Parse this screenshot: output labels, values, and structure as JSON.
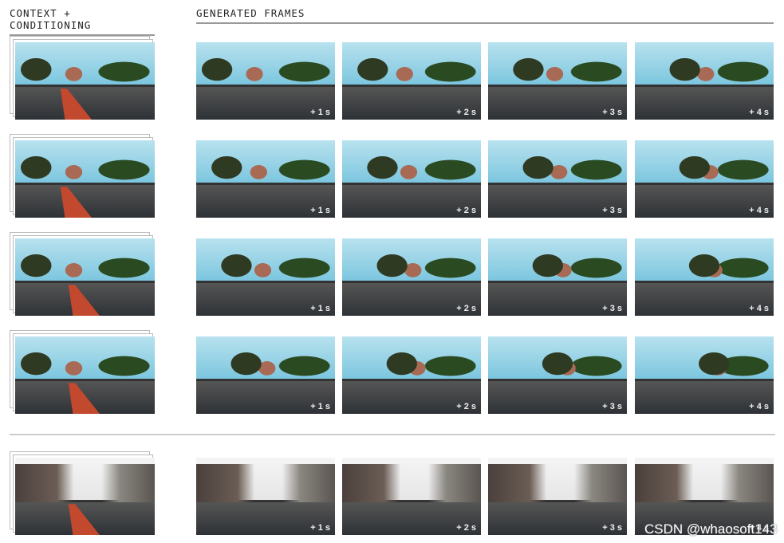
{
  "headers": {
    "context": "CONTEXT + CONDITIONING",
    "generated": "GENERATED FRAMES"
  },
  "frame_labels": [
    "+ 1 s",
    "+ 2 s",
    "+ 3 s",
    "+ 4 s"
  ],
  "rows": [
    {
      "scene": "suburban-sunny",
      "conditioning": "red-path-straight"
    },
    {
      "scene": "suburban-sunny",
      "conditioning": "red-path-straight"
    },
    {
      "scene": "suburban-sunny",
      "conditioning": "red-path-right"
    },
    {
      "scene": "suburban-sunny",
      "conditioning": "red-path-right"
    },
    {
      "scene": "urban-overcast",
      "conditioning": "red-path-right"
    }
  ],
  "colors": {
    "path": "#c2482e",
    "sky": "#8fd0e6",
    "overcast_sky": "#f2f2f2"
  },
  "watermark": "CSDN @whaosoft143"
}
